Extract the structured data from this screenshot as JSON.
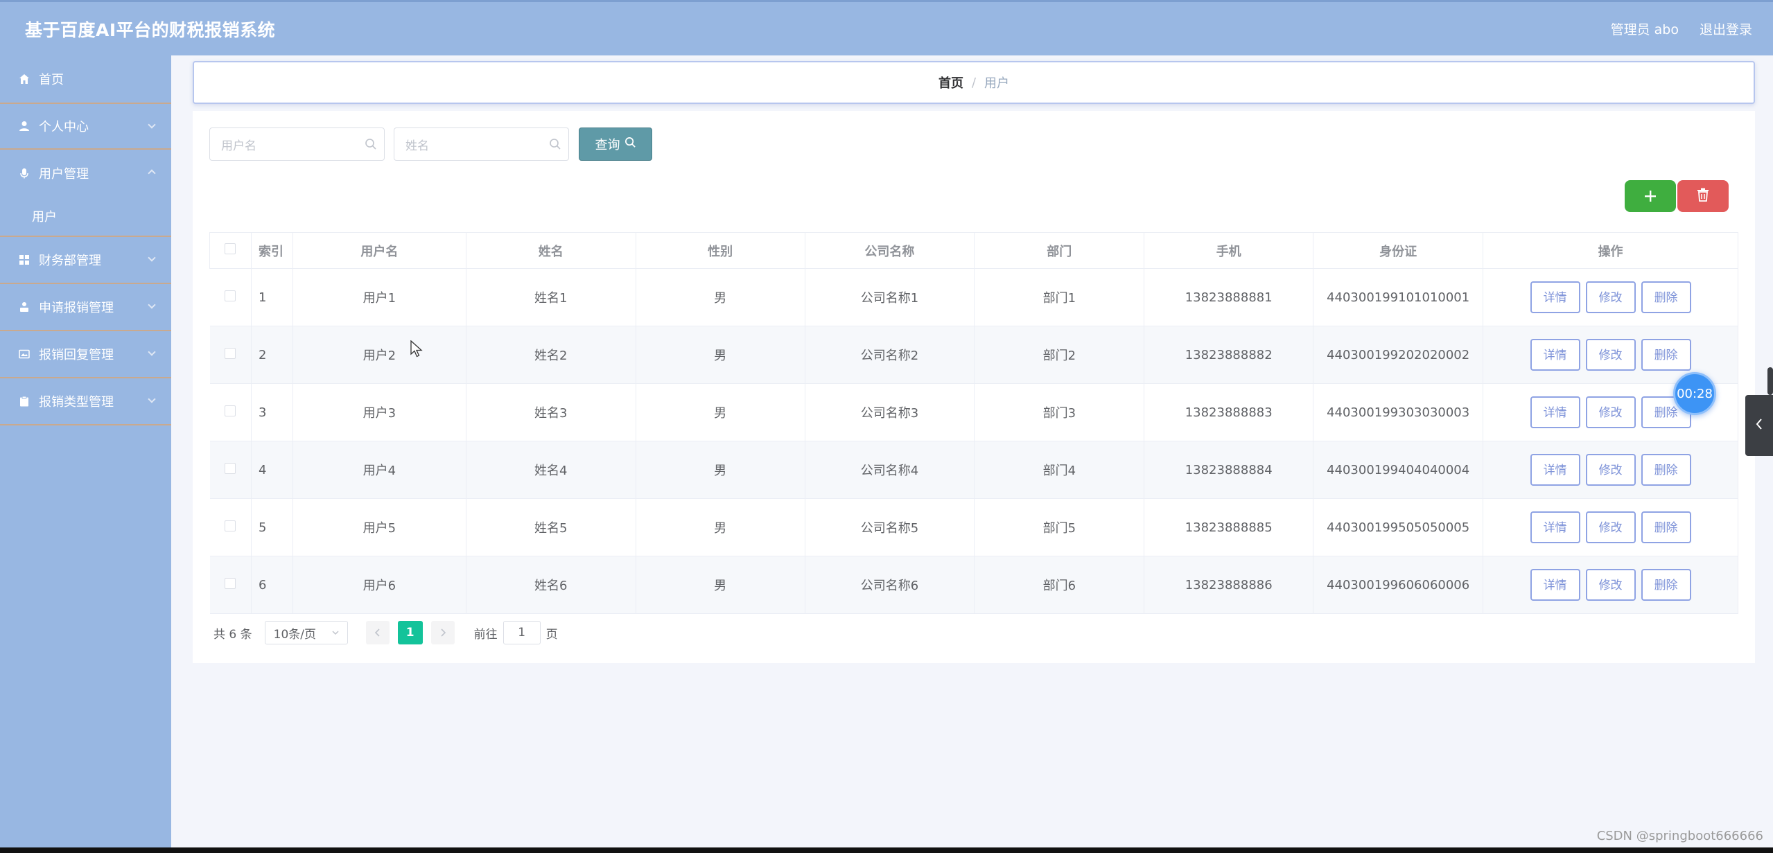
{
  "header": {
    "title": "基于百度AI平台的财税报销系统",
    "user_label": "管理员 abo",
    "logout_label": "退出登录"
  },
  "sidebar": {
    "items": [
      {
        "label": "首页",
        "icon": "home-icon"
      },
      {
        "label": "个人中心",
        "icon": "user-icon"
      },
      {
        "label": "用户管理",
        "icon": "mic-icon"
      },
      {
        "label": "财务部管理",
        "icon": "grid-icon"
      },
      {
        "label": "申请报销管理",
        "icon": "person-icon"
      },
      {
        "label": "报销回复管理",
        "icon": "image-icon"
      },
      {
        "label": "报销类型管理",
        "icon": "clipboard-icon"
      }
    ],
    "sub_user": "用户"
  },
  "breadcrumb": {
    "home": "首页",
    "separator": "/",
    "current": "用户"
  },
  "search": {
    "username_placeholder": "用户名",
    "name_placeholder": "姓名",
    "query_label": "查询"
  },
  "table": {
    "headers": [
      "索引",
      "用户名",
      "姓名",
      "性别",
      "公司名称",
      "部门",
      "手机",
      "身份证",
      "操作"
    ],
    "rows": [
      [
        "1",
        "用户1",
        "姓名1",
        "男",
        "公司名称1",
        "部门1",
        "13823888881",
        "440300199101010001"
      ],
      [
        "2",
        "用户2",
        "姓名2",
        "男",
        "公司名称2",
        "部门2",
        "13823888882",
        "440300199202020002"
      ],
      [
        "3",
        "用户3",
        "姓名3",
        "男",
        "公司名称3",
        "部门3",
        "13823888883",
        "440300199303030003"
      ],
      [
        "4",
        "用户4",
        "姓名4",
        "男",
        "公司名称4",
        "部门4",
        "13823888884",
        "440300199404040004"
      ],
      [
        "5",
        "用户5",
        "姓名5",
        "男",
        "公司名称5",
        "部门5",
        "13823888885",
        "440300199505050005"
      ],
      [
        "6",
        "用户6",
        "姓名6",
        "男",
        "公司名称6",
        "部门6",
        "13823888886",
        "440300199606060006"
      ]
    ],
    "actions": {
      "detail": "详情",
      "edit": "修改",
      "delete": "删除"
    }
  },
  "pagination": {
    "total": "共 6 条",
    "page_size": "10条/页",
    "current_page": "1",
    "goto_prefix": "前往",
    "goto_value": "1",
    "goto_suffix": "页"
  },
  "timer": "00:28",
  "watermark": "CSDN @springboot666666",
  "colors": {
    "header_bg": "#98b7e2",
    "query_btn": "#5f9aa7",
    "add_btn": "#3fae3f",
    "delete_btn": "#e25a5a",
    "page_active": "#13c39a",
    "action_border": "#8fa3e4"
  }
}
